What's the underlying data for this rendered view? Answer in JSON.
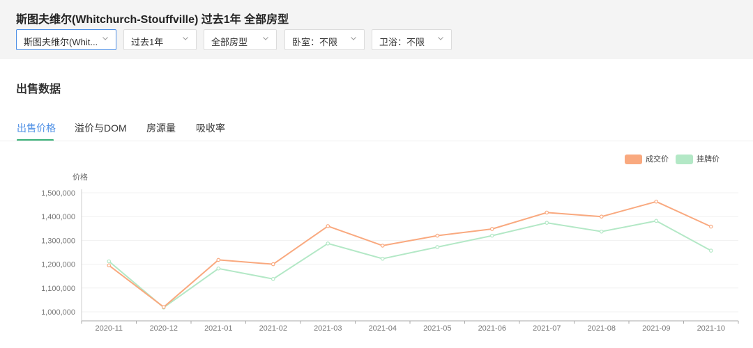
{
  "header": {
    "title": "斯图夫维尔(Whitchurch-Stouffville) 过去1年 全部房型"
  },
  "filters": [
    {
      "value": "斯图夫维尔(Whit...",
      "active": true
    },
    {
      "value": "过去1年",
      "active": false
    },
    {
      "value": "全部房型",
      "active": false
    },
    {
      "value": "卧室：不限",
      "active": false
    },
    {
      "value": "卫浴：不限",
      "active": false
    }
  ],
  "section": {
    "title": "出售数据"
  },
  "tabs": [
    {
      "label": "出售价格",
      "active": true
    },
    {
      "label": "溢价与DOM",
      "active": false
    },
    {
      "label": "房源量",
      "active": false
    },
    {
      "label": "吸收率",
      "active": false
    }
  ],
  "colors": {
    "accent": "#4d8fe6",
    "tab_underline": "#3bb27a"
  },
  "chart_data": {
    "type": "line",
    "ylabel": "价格",
    "xlabel": "",
    "categories": [
      "2020-11",
      "2020-12",
      "2021-01",
      "2021-02",
      "2021-03",
      "2021-04",
      "2021-05",
      "2021-06",
      "2021-07",
      "2021-08",
      "2021-09",
      "2021-10"
    ],
    "yticks": [
      "1,000,000",
      "1,100,000",
      "1,200,000",
      "1,300,000",
      "1,400,000",
      "1,500,000"
    ],
    "ylim": [
      980000,
      1525000
    ],
    "grid": true,
    "legend_position": "top-right",
    "series": [
      {
        "name": "成交价",
        "color": "#f9a97f",
        "values": [
          1195000,
          1020000,
          1218000,
          1200000,
          1360000,
          1278000,
          1320000,
          1348000,
          1417000,
          1400000,
          1463000,
          1358000
        ]
      },
      {
        "name": "挂牌价",
        "color": "#b3e8c6",
        "values": [
          1212000,
          1018000,
          1182000,
          1138000,
          1287000,
          1223000,
          1272000,
          1320000,
          1374000,
          1337000,
          1382000,
          1257000
        ]
      }
    ]
  }
}
